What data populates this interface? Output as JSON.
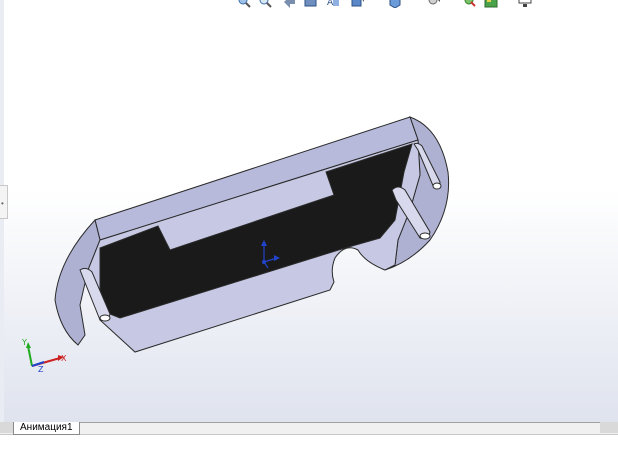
{
  "viewport": {
    "background_top": "#ffffff",
    "background_bottom": "#dfe3ee"
  },
  "toolbar": {
    "icons": [
      "zoom-to-fit-icon",
      "zoom-area-icon",
      "previous-view-icon",
      "section-view-icon",
      "dynamic-annotation-icon",
      "view-orientation-icon",
      "display-style-icon",
      "hide-show-items-icon",
      "edit-appearance-icon",
      "apply-scene-icon",
      "view-settings-icon"
    ]
  },
  "part": {
    "face_color": "#c7c9e4",
    "side_color": "#aeb1d2",
    "pocket_color": "#1a1a1a",
    "edge_color": "#2a2a2a"
  },
  "triad": {
    "x_label": "X",
    "y_label": "Y",
    "z_label": "Z",
    "x_color": "#cc2222",
    "y_color": "#22aa22",
    "z_color": "#2244cc"
  },
  "bottom": {
    "tab_label": "Анимация1"
  }
}
